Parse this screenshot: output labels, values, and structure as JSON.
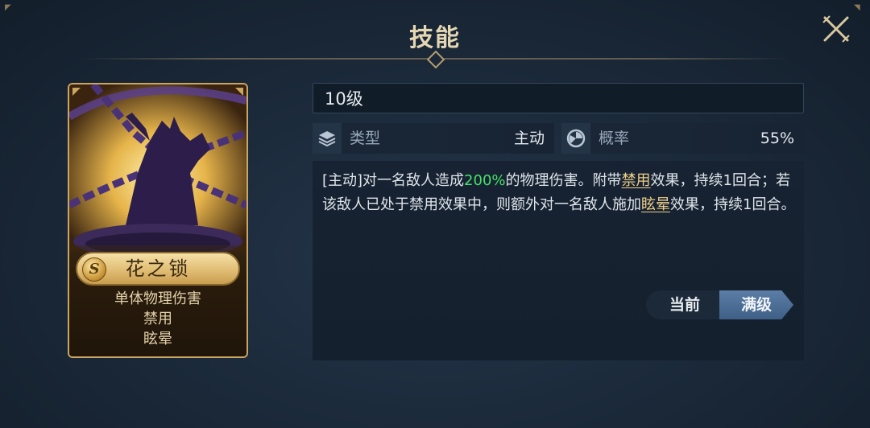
{
  "header": {
    "title": "技能"
  },
  "card": {
    "name": "花之锁",
    "rank_badge": "S",
    "tags": [
      "单体物理伤害",
      "禁用",
      "眩晕"
    ]
  },
  "skill": {
    "level": "10级",
    "type_label": "类型",
    "type_value": "主动",
    "rate_label": "概率",
    "rate_value": "55%",
    "description": {
      "p1": "[主动]对一名敌人造成",
      "damage": "200%",
      "p2": "的物理伤害。附带",
      "link1": "禁用",
      "p3": "效果，持续1回合；若该敌人已处于禁用效果中，则额外对一名敌人施加",
      "link2": "眩晕",
      "p4": "效果，持续1回合。"
    }
  },
  "buttons": {
    "current": "当前",
    "max": "满级"
  },
  "colors": {
    "gold": "#caa660",
    "green": "#48e06a",
    "link": "#f0d08a",
    "accent": "#4e6f96"
  }
}
